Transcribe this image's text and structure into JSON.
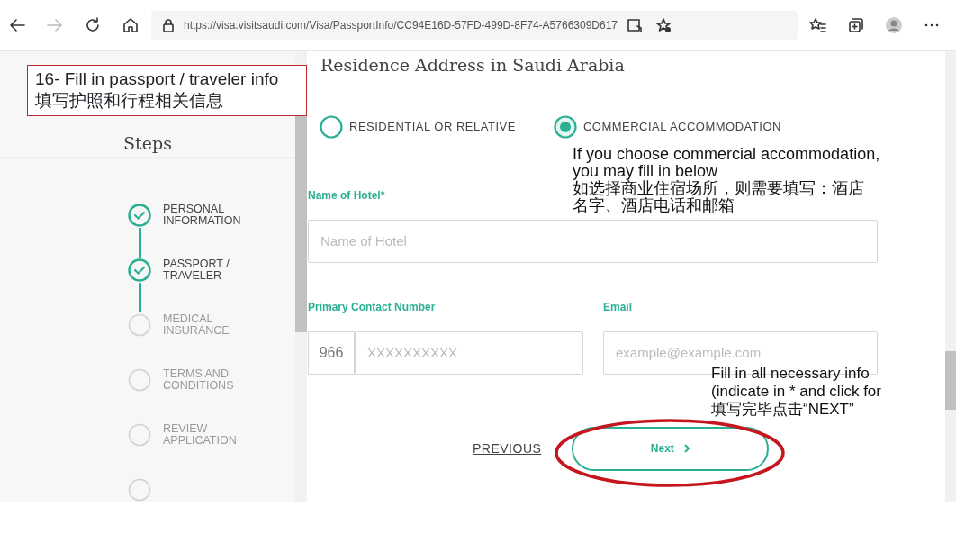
{
  "browser": {
    "url": "https://visa.visitsaudi.com/Visa/PassportInfo/CC94E16D-57FD-499D-8F74-A5766309D617",
    "forward_disabled": true
  },
  "sidebar": {
    "title": "Steps",
    "steps": [
      {
        "label": "PERSONAL INFORMATION",
        "done": true
      },
      {
        "label": "PASSPORT / TRAVELER",
        "done": true
      },
      {
        "label": "MEDICAL INSURANCE",
        "done": false
      },
      {
        "label": "TERMS AND CONDITIONS",
        "done": false
      },
      {
        "label": "REVIEW APPLICATION",
        "done": false
      },
      {
        "done": false
      }
    ]
  },
  "form": {
    "heading": "Residence Address in Saudi Arabia",
    "radios": [
      {
        "label": "RESIDENTIAL OR RELATIVE",
        "selected": false
      },
      {
        "label": "COMMERCIAL ACCOMMODATION",
        "selected": true
      }
    ],
    "hotel": {
      "label": "Name of Hotel*",
      "placeholder": "Name of Hotel"
    },
    "phone": {
      "label": "Primary Contact Number",
      "prefix": "966",
      "placeholder": "XXXXXXXXXX"
    },
    "email": {
      "label": "Email",
      "placeholder": "example@example.com"
    },
    "previous": "PREVIOUS",
    "next": "Next"
  },
  "annotations": {
    "title_box": [
      "16- Fill in passport / traveler info",
      "填写护照和行程相关信息"
    ],
    "notes": [
      [
        "If you choose commercial accommodation,",
        "you may fill in below",
        "如选择商业住宿场所，则需要填写：酒店",
        "名字、酒店电话和邮箱"
      ],
      [
        "Fill in all necessary info",
        "(indicate in * and click for",
        "填写完毕点击“NEXT”"
      ]
    ]
  }
}
